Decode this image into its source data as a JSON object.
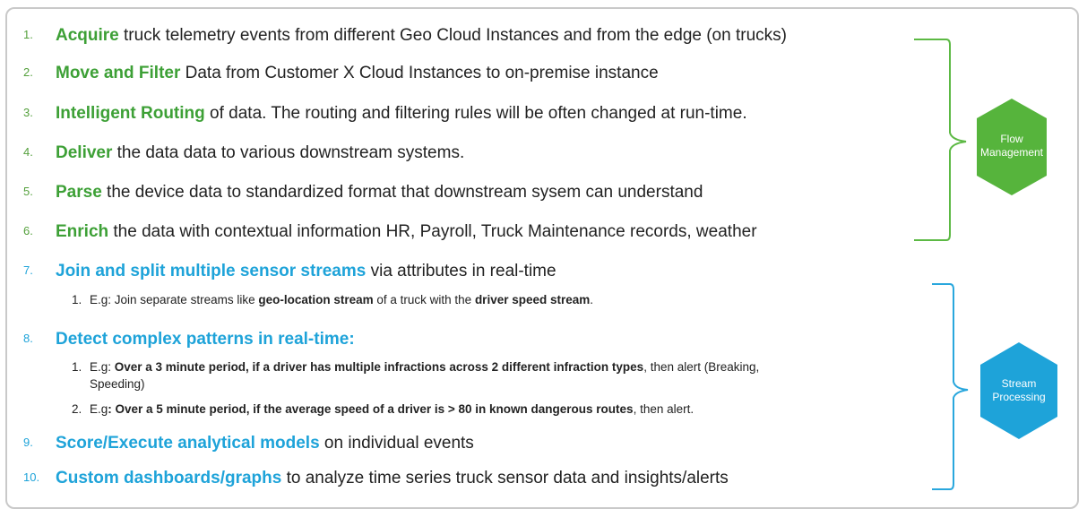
{
  "items": [
    {
      "num": "1.",
      "kw": "Acquire",
      "rest": " truck telemetry events from different Geo Cloud Instances and from the edge (on trucks)"
    },
    {
      "num": "2.",
      "kw": "Move and Filter",
      "rest": " Data from Customer X Cloud Instances to on-premise instance"
    },
    {
      "num": "3.",
      "kw": "Intelligent Routing",
      "rest": " of data. The routing and filtering rules will be often changed at run-time."
    },
    {
      "num": "4.",
      "kw": "Deliver",
      "rest": " the data data to various downstream systems."
    },
    {
      "num": "5.",
      "kw": "Parse",
      "rest": " the device data to standardized format that downstream sysem can understand"
    },
    {
      "num": "6.",
      "kw": "Enrich",
      "rest": " the data with contextual information HR, Payroll, Truck Maintenance records, weather"
    },
    {
      "num": "7.",
      "kw": "Join and split multiple sensor streams",
      "rest": " via attributes in real-time"
    },
    {
      "num": "8.",
      "kw": "Detect complex patterns in real-time:",
      "rest": ""
    },
    {
      "num": "9.",
      "kw": "Score/Execute analytical models",
      "rest": " on individual events"
    },
    {
      "num": "10.",
      "kw": "Custom dashboards/graphs",
      "rest": " to analyze time series truck sensor data and insights/alerts"
    }
  ],
  "sub7": [
    {
      "num": "1.",
      "a": "E.g: Join separate streams like ",
      "b": "geo-location stream",
      "c": " of a truck with the ",
      "d": "driver speed stream",
      "e": "."
    }
  ],
  "sub8": [
    {
      "num": "1.",
      "a": "E.g: ",
      "b": "Over a 3 minute period, if a driver has multiple infractions across 2 different infraction types",
      "c": ", then alert (Breaking,",
      "d": "Speeding)"
    },
    {
      "num": "2.",
      "a": "E.g",
      "b": ": Over a 5 minute period, if the average speed of a driver is > 80 in known dangerous routes",
      "c": ", then alert."
    }
  ],
  "groups": {
    "flow": {
      "line1": "Flow",
      "line2": "Management",
      "color": "#56b43c"
    },
    "stream": {
      "line1": "Stream",
      "line2": "Processing",
      "color": "#1ea3d9"
    }
  }
}
